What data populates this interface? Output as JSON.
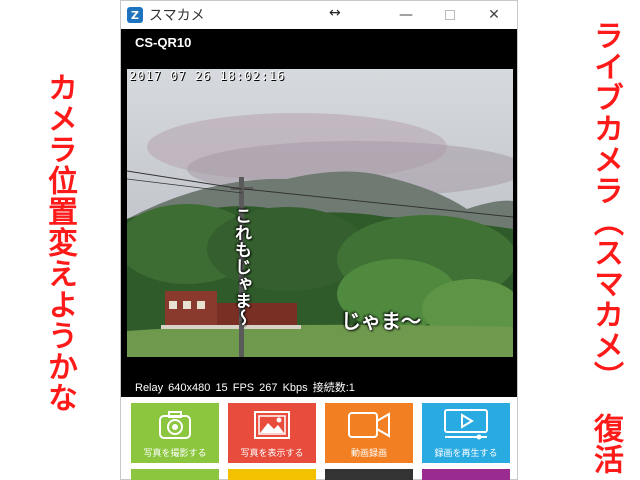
{
  "captions": {
    "left": "カメラ位置変えようかな",
    "right_line1": "ライブカメラ（スマカメ）",
    "right_line2": "復活"
  },
  "window": {
    "title": "スマカメ",
    "icon_glyph": "Z",
    "resize_glyph": "↔",
    "minimize_glyph": "—",
    "close_glyph": "✕"
  },
  "viewer": {
    "camera_name": "CS-QR10",
    "timestamp": "2017 07 26 18:02:16",
    "overlay_vertical": "これもじゃま～",
    "overlay_horizontal": "じゃま～",
    "status": "Relay  640x480  15 FPS  267 Kbps  接続数:1"
  },
  "buttons": [
    {
      "label": "写真を撮影する",
      "color": "#8cc63f",
      "icon": "camera-icon"
    },
    {
      "label": "写真を表示する",
      "color": "#e74c3c",
      "icon": "picture-icon"
    },
    {
      "label": "動画録画",
      "color": "#f27f22",
      "icon": "video-camera-icon"
    },
    {
      "label": "録画を再生する",
      "color": "#29abe2",
      "icon": "play-icon"
    }
  ],
  "second_row_colors": [
    "#8cc63f",
    "#f2c200",
    "#333333",
    "#9b2c8f"
  ]
}
